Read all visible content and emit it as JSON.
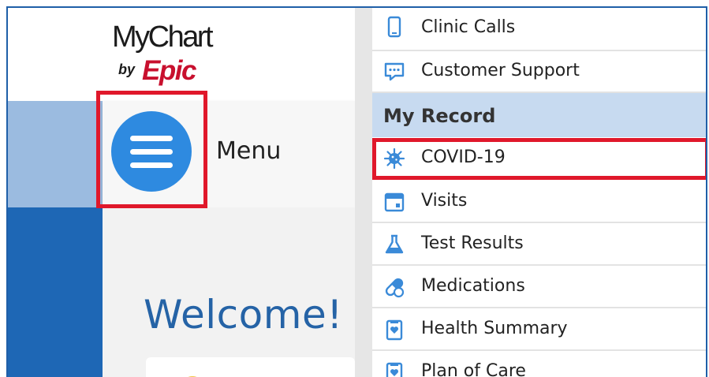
{
  "logo": {
    "brand": "MyChart",
    "by": "by",
    "company": "Epic"
  },
  "menu": {
    "label": "Menu"
  },
  "welcome": {
    "heading": "Welcome!"
  },
  "nav": {
    "top_items": [
      {
        "label": "Clinic Calls",
        "icon": "phone-icon"
      },
      {
        "label": "Customer Support",
        "icon": "chat-icon"
      }
    ],
    "section_title": "My Record",
    "record_items": [
      {
        "label": "COVID-19",
        "icon": "virus-icon"
      },
      {
        "label": "Visits",
        "icon": "calendar-icon"
      },
      {
        "label": "Test Results",
        "icon": "flask-icon"
      },
      {
        "label": "Medications",
        "icon": "pill-icon"
      },
      {
        "label": "Health Summary",
        "icon": "heart-document-icon"
      },
      {
        "label": "Plan of Care",
        "icon": "heart-document-icon"
      }
    ]
  },
  "colors": {
    "accent": "#2e8ae0",
    "icon_blue": "#3a8ad8",
    "highlight": "#e0182b",
    "epic_red": "#c8102e",
    "welcome_blue": "#2563a6",
    "section_bg": "#c7daf0"
  }
}
